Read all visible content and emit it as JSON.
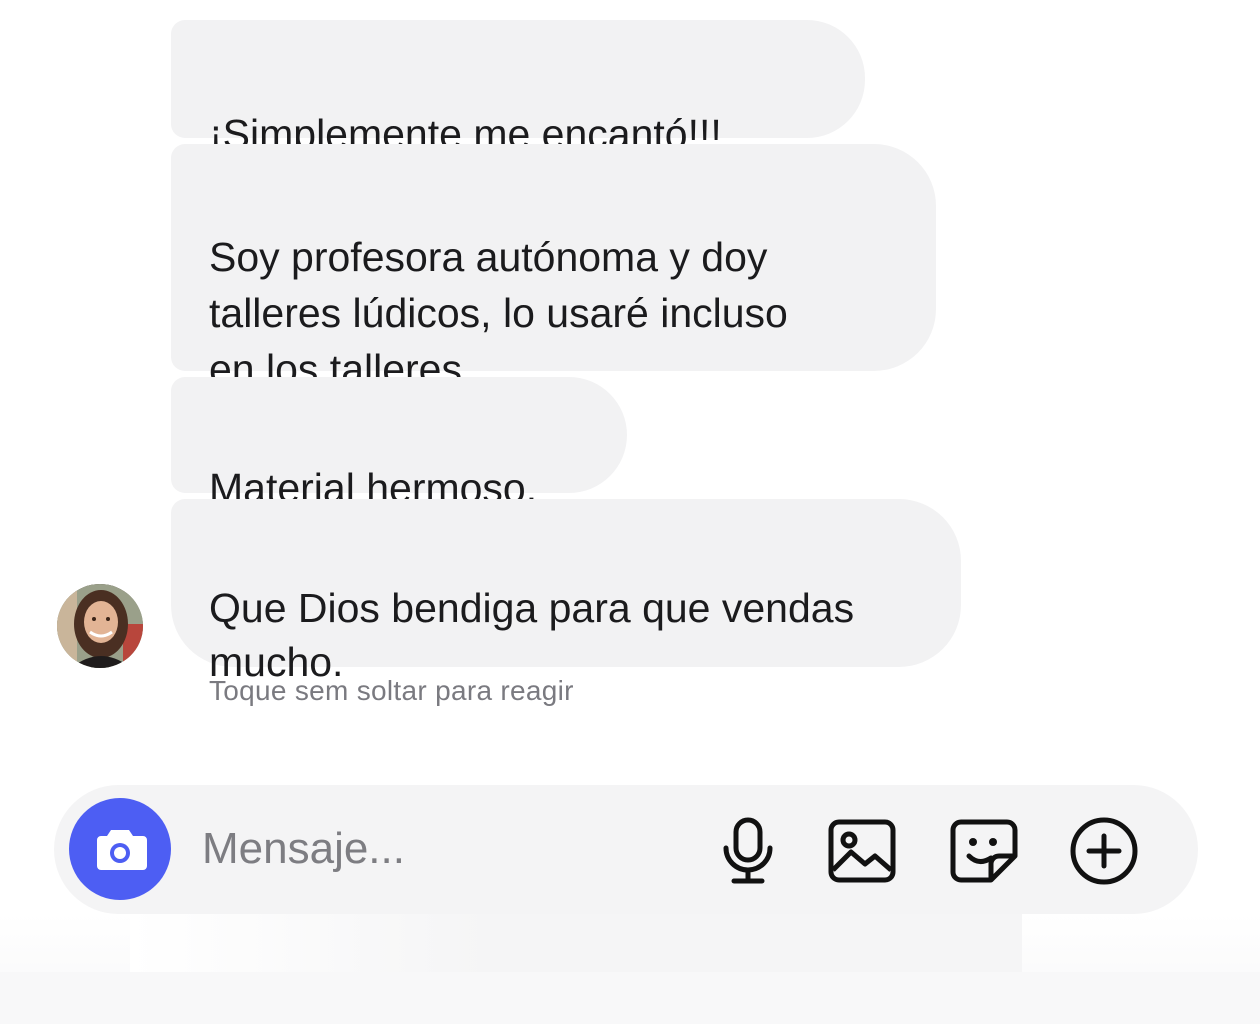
{
  "messages": [
    {
      "text": "¡Simplemente me encantó!!!"
    },
    {
      "text": "Soy profesora autónoma y doy\ntalleres lúdicos, lo usaré incluso\nen los talleres."
    },
    {
      "text": "Material hermoso."
    },
    {
      "text": "Que Dios bendiga para que vendas\nmucho."
    }
  ],
  "reaction_hint": "Toque sem soltar para reagir",
  "composer": {
    "placeholder": "Mensaje...",
    "value": "",
    "camera_icon": "camera-icon",
    "mic_icon": "microphone-icon",
    "gallery_icon": "gallery-icon",
    "sticker_icon": "sticker-icon",
    "add_icon": "plus-circle-icon"
  },
  "colors": {
    "bubble_bg": "#f2f2f3",
    "camera_button": "#4d5ef3",
    "hint_text": "#7a7a80"
  }
}
